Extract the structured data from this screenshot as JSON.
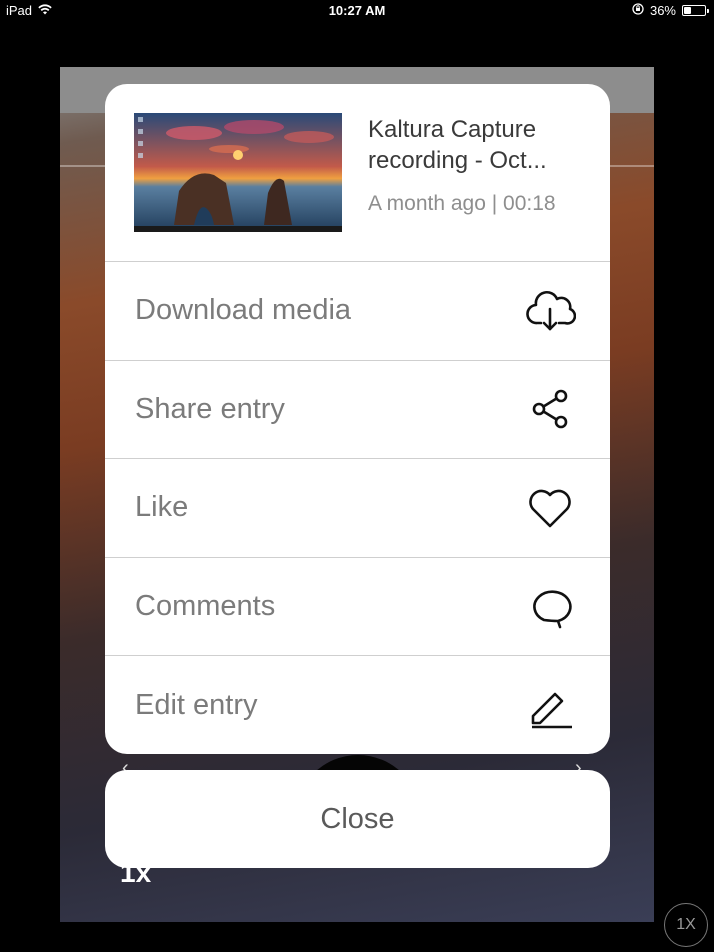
{
  "status_bar": {
    "device": "iPad",
    "time": "10:27 AM",
    "battery_percent": "36%",
    "battery_level": 0.36,
    "icons": [
      "wifi-icon",
      "orientation-lock-icon",
      "battery-icon"
    ]
  },
  "background_player": {
    "speed_label": "1x",
    "speed_badge": "1X"
  },
  "entry": {
    "title_line1": "Kaltura Capture",
    "title_line2": "recording - Oct...",
    "meta": "A month ago | 00:18",
    "thumbnail_icon": "video-thumbnail"
  },
  "menu": [
    {
      "label": "Download media",
      "icon": "cloud-download-icon"
    },
    {
      "label": "Share entry",
      "icon": "share-icon"
    },
    {
      "label": "Like",
      "icon": "heart-icon"
    },
    {
      "label": "Comments",
      "icon": "comment-icon"
    },
    {
      "label": "Edit entry",
      "icon": "edit-pencil-icon"
    }
  ],
  "close_label": "Close",
  "colors": {
    "sheet_bg": "#ffffff",
    "label_gray": "#7b7b7b",
    "divider": "#cfcfcf"
  }
}
